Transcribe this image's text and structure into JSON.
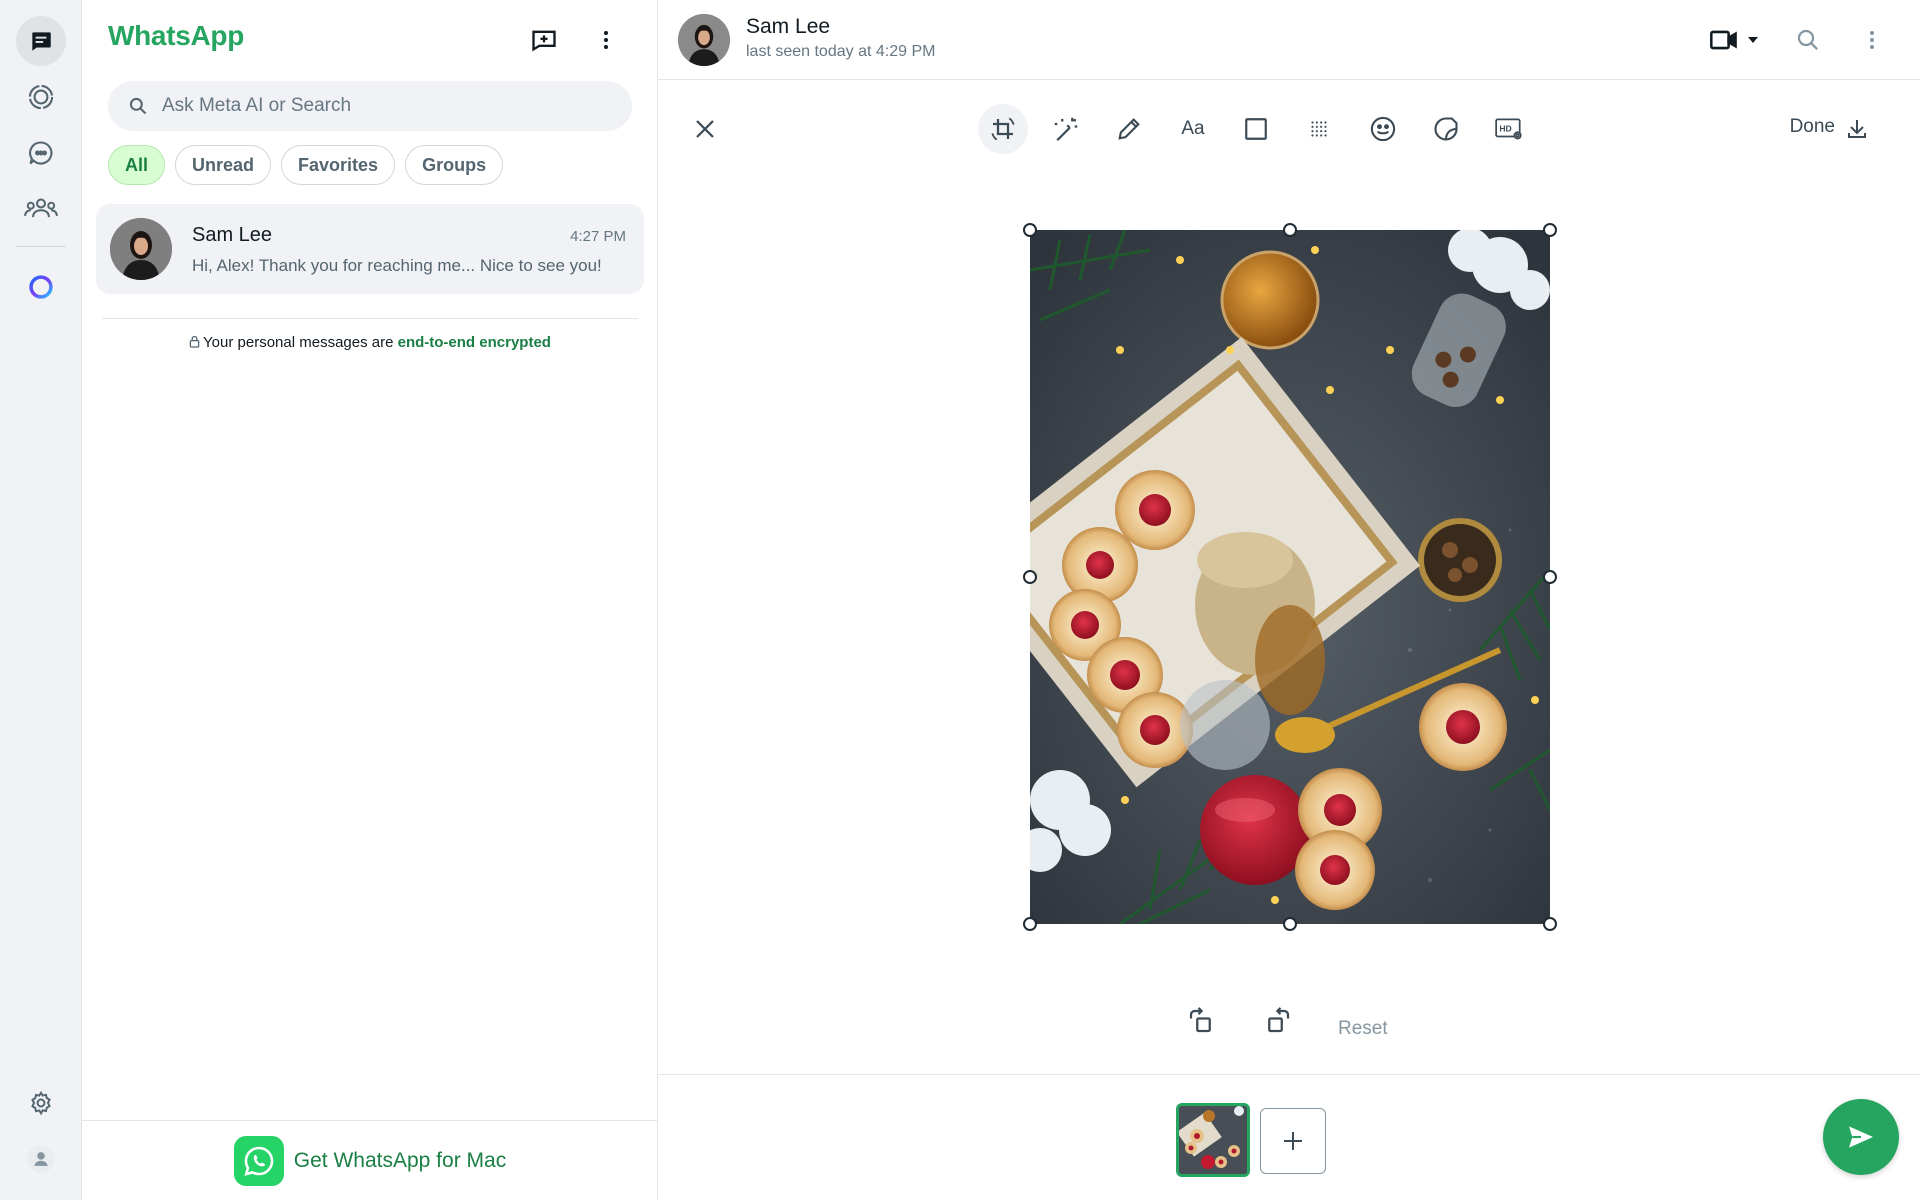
{
  "rail": {
    "items": [
      {
        "name": "chats",
        "icon": "chats-icon",
        "active": true
      },
      {
        "name": "status",
        "icon": "status-icon"
      },
      {
        "name": "channels",
        "icon": "channels-icon"
      },
      {
        "name": "communities",
        "icon": "communities-icon"
      },
      {
        "name": "meta-ai",
        "icon": "meta-ai-icon"
      }
    ],
    "bottom": [
      {
        "name": "settings",
        "icon": "gear-icon"
      },
      {
        "name": "profile",
        "icon": "profile-icon"
      }
    ]
  },
  "sidebar": {
    "app_title": "WhatsApp",
    "search_placeholder": "Ask Meta AI or Search",
    "filters": [
      "All",
      "Unread",
      "Favorites",
      "Groups"
    ],
    "active_filter": "All",
    "chats": [
      {
        "name": "Sam Lee",
        "time": "4:27 PM",
        "preview": "Hi, Alex! Thank you for reaching me... Nice to see you!"
      }
    ],
    "encryption_note": {
      "prefix": "Your personal messages are ",
      "link": "end-to-end encrypted"
    },
    "get_app": "Get WhatsApp for Mac"
  },
  "conversation": {
    "contact_name": "Sam Lee",
    "contact_status": "last seen today at 4:29 PM"
  },
  "editor": {
    "tools": [
      "crop-rotate",
      "magic-wand",
      "pencil",
      "text",
      "rectangle",
      "blur",
      "emoji",
      "sticker",
      "hd-quality"
    ],
    "text_tool_label": "Aa",
    "done_label": "Done",
    "reset_label": "Reset"
  },
  "colors": {
    "brand_green": "#25a560",
    "link_green": "#1a7f44",
    "chip_active_bg": "#d9fdd3",
    "rail_bg": "#f0f2f5"
  }
}
